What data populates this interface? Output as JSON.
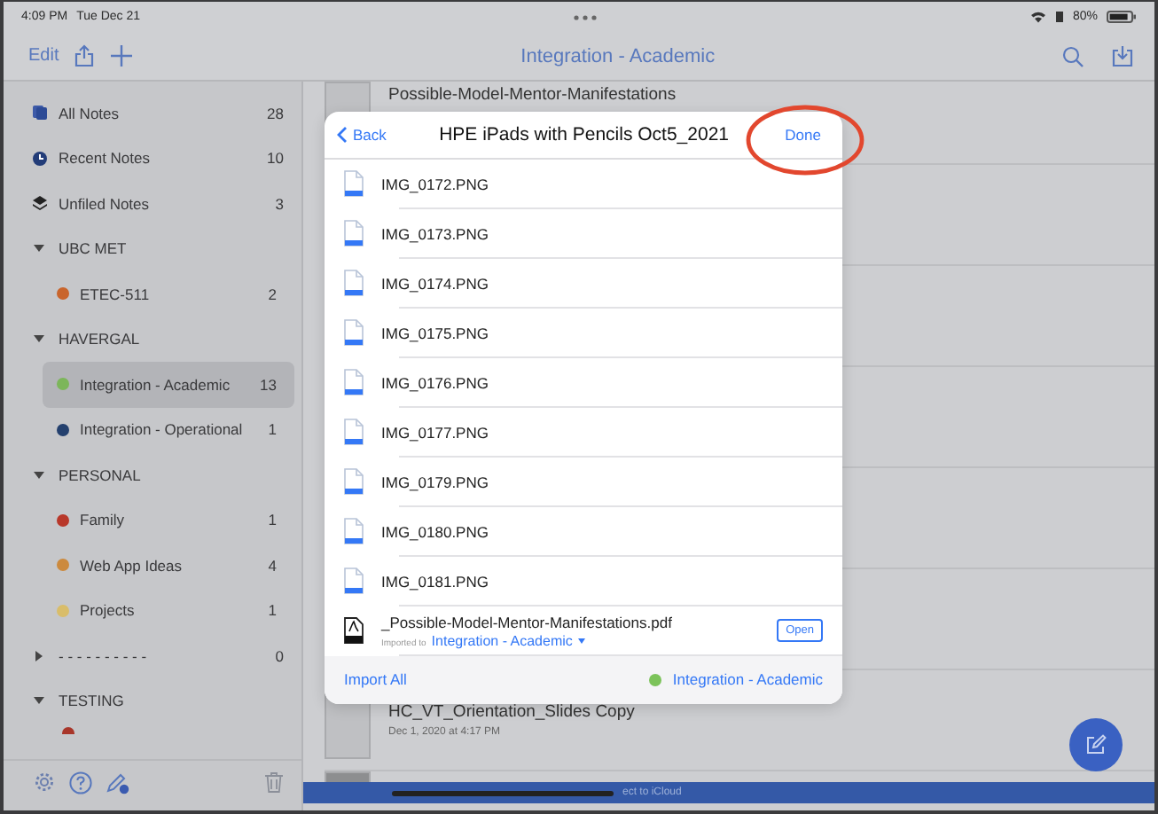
{
  "status_bar": {
    "time": "4:09 PM",
    "date": "Tue Dec 21",
    "battery": "80%"
  },
  "nav_bar": {
    "edit": "Edit",
    "title": "Integration - Academic"
  },
  "sidebar": {
    "items": [
      {
        "kind": "smart",
        "label": "All Notes",
        "count": "28",
        "selected": false
      },
      {
        "kind": "smart",
        "label": "Recent Notes",
        "count": "10",
        "selected": false
      },
      {
        "kind": "smart",
        "label": "Unfiled Notes",
        "count": "3",
        "selected": false
      },
      {
        "kind": "group",
        "label": "UBC MET",
        "expanded": true,
        "children": [
          {
            "label": "ETEC-511",
            "count": "2",
            "color": "#c9652c",
            "selected": false
          }
        ]
      },
      {
        "kind": "group",
        "label": "HAVERGAL",
        "expanded": true,
        "children": [
          {
            "label": "Integration - Academic",
            "count": "13",
            "color": "#7cb65a",
            "selected": true
          },
          {
            "label": "Integration - Operational",
            "count": "1",
            "color": "#24406e",
            "selected": false
          }
        ]
      },
      {
        "kind": "group",
        "label": "PERSONAL",
        "expanded": true,
        "children": [
          {
            "label": "Family",
            "count": "1",
            "color": "#b8382a",
            "selected": false
          },
          {
            "label": "Web App Ideas",
            "count": "4",
            "color": "#cc8a3e",
            "selected": false
          },
          {
            "label": "Projects",
            "count": "1",
            "color": "#d9bd6a",
            "selected": false
          }
        ]
      },
      {
        "kind": "group",
        "label": "- - - - - - - - - -",
        "count": "0",
        "expanded": false
      },
      {
        "kind": "group",
        "label": "TESTING",
        "expanded": true
      }
    ]
  },
  "notes": [
    {
      "title": "Possible-Model-Mentor-Manifestations"
    },
    {
      "title": "HC_VT_Orientation_Slides Copy",
      "date": "Dec 1, 2020 at 4:17 PM"
    }
  ],
  "banner": {
    "text": "ect to iCloud"
  },
  "import_sheet": {
    "back": "Back",
    "title": "HPE iPads with Pencils Oct5_2021",
    "done": "Done",
    "files": [
      {
        "kind": "image",
        "name": "IMG_0172.PNG"
      },
      {
        "kind": "image",
        "name": "IMG_0173.PNG"
      },
      {
        "kind": "image",
        "name": "IMG_0174.PNG"
      },
      {
        "kind": "image",
        "name": "IMG_0175.PNG"
      },
      {
        "kind": "image",
        "name": "IMG_0176.PNG"
      },
      {
        "kind": "image",
        "name": "IMG_0177.PNG"
      },
      {
        "kind": "image",
        "name": "IMG_0179.PNG"
      },
      {
        "kind": "image",
        "name": "IMG_0180.PNG"
      },
      {
        "kind": "image",
        "name": "IMG_0181.PNG"
      },
      {
        "kind": "pdf",
        "name": "_Possible-Model-Mentor-Manifestations.pdf",
        "imported_label": "Imported to",
        "imported_to": "Integration - Academic",
        "action": "Open"
      }
    ],
    "import_all": "Import All",
    "destination": {
      "label": "Integration - Academic",
      "color": "#7cc35a"
    }
  },
  "annotation": {
    "kind": "ellipse"
  }
}
